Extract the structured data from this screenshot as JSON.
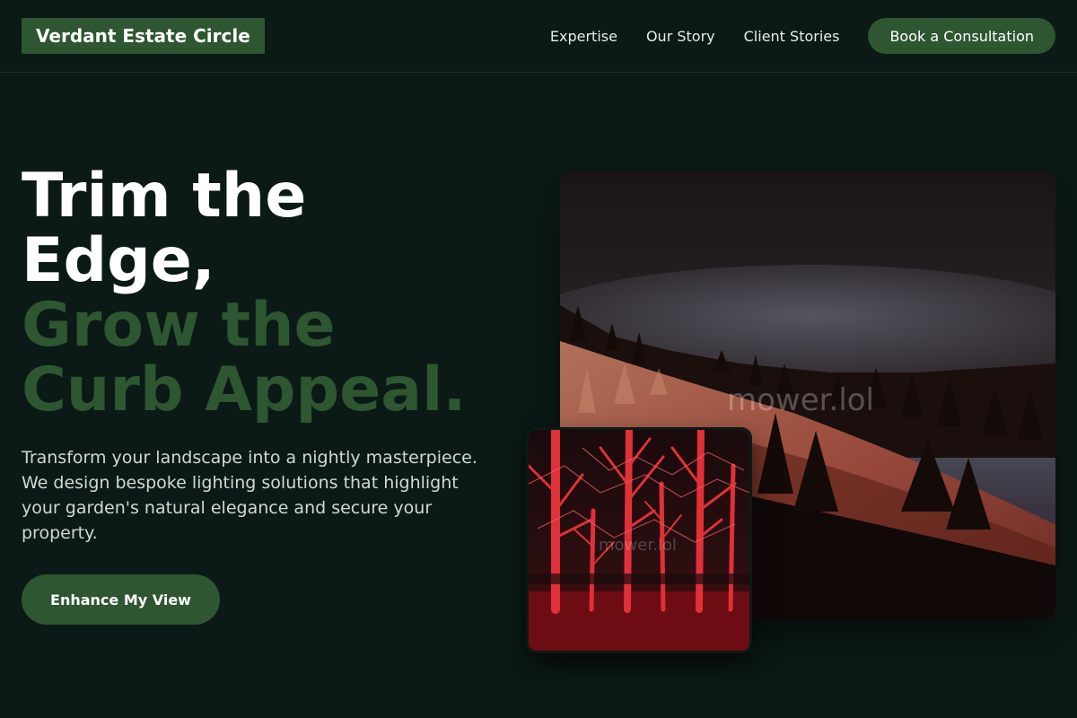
{
  "header": {
    "brand": "Verdant Estate Circle",
    "nav": [
      "Expertise",
      "Our Story",
      "Client Stories"
    ],
    "cta_label": "Book a Consultation"
  },
  "hero": {
    "title_white": [
      "Trim the",
      "Edge,"
    ],
    "title_green": [
      "Grow the",
      "Curb Appeal."
    ],
    "subtitle": "Transform your landscape into a nightly masterpiece. We design bespoke lighting solutions that highlight your garden's natural elegance and secure your property.",
    "button_label": "Enhance My View"
  },
  "images": {
    "main_watermark": "mower.lol",
    "small_watermark": "mower.lol"
  },
  "colors": {
    "background": "#0b1a16",
    "accent_green": "#2e5631",
    "text_light": "#d2d8d4"
  }
}
